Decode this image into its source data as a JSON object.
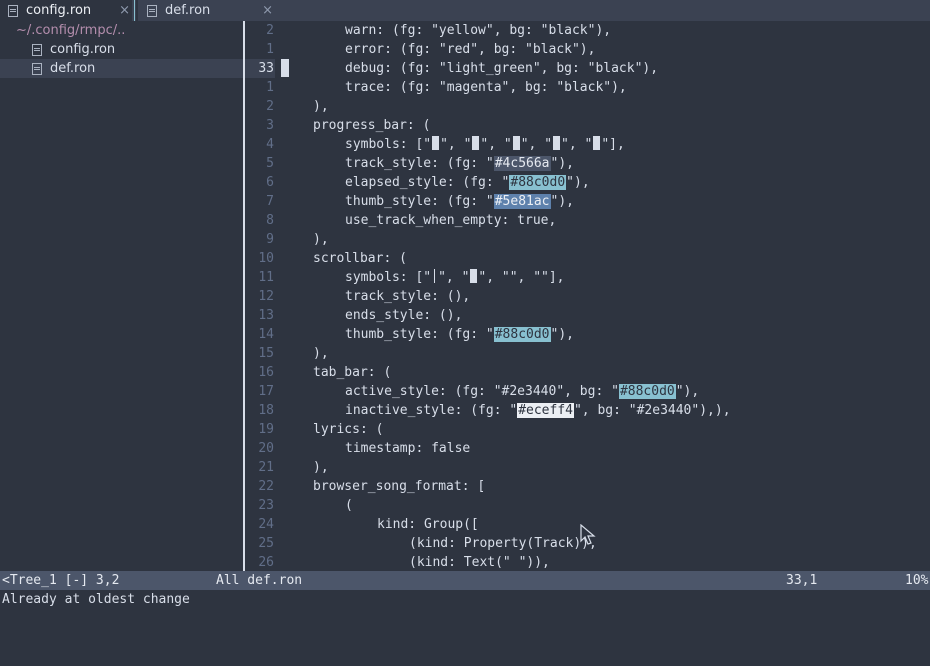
{
  "tabs": [
    {
      "label": "config.ron",
      "close": "×"
    },
    {
      "label": "def.ron",
      "close": "×"
    }
  ],
  "sidebar": {
    "root": "~/.config/rmpc/..",
    "files": [
      "config.ron",
      "def.ron"
    ],
    "active_file": "def.ron"
  },
  "editor": {
    "line_numbers": [
      "2",
      "1",
      "33",
      "1",
      "2",
      "3",
      "4",
      "5",
      "6",
      "7",
      "8",
      "9",
      "10",
      "11",
      "12",
      "13",
      "14",
      "15",
      "16",
      "17",
      "18",
      "19",
      "20",
      "21",
      "22",
      "23",
      "24",
      "25",
      "26"
    ],
    "current_line_index": 2,
    "lines": {
      "l0": "warn: (fg: \"yellow\", bg: \"black\"),",
      "l1": "error: (fg: \"red\", bg: \"black\"),",
      "l2": "debug: (fg: \"light_green\", bg: \"black\"),",
      "l3": "trace: (fg: \"magenta\", bg: \"black\"),",
      "l4": "),",
      "l5": "progress_bar: (",
      "l6a": "symbols: [\"",
      "l6b": "\", \"",
      "l6c": "\", \"",
      "l6d": "\", \"",
      "l6e": "\", \"",
      "l6f": "\"],",
      "l7a": "track_style: (fg: \"",
      "l7b": "#4c566a",
      "l7c": "\"),",
      "l8a": "elapsed_style: (fg: \"",
      "l8b": "#88c0d0",
      "l8c": "\"),",
      "l9a": "thumb_style: (fg: \"",
      "l9b": "#5e81ac",
      "l9c": "\"),",
      "l10": "use_track_when_empty: true,",
      "l11": "),",
      "l12": "scrollbar: (",
      "l13a": "symbols: [\"",
      "l13b": "\", \"",
      "l13c": "\", \"\", \"\"],",
      "l14": "track_style: (),",
      "l15": "ends_style: (),",
      "l16a": "thumb_style: (fg: \"",
      "l16b": "#88c0d0",
      "l16c": "\"),",
      "l17": "),",
      "l18": "tab_bar: (",
      "l19a": "active_style: (fg: \"#2e3440\", bg: \"",
      "l19b": "#88c0d0",
      "l19c": "\"),",
      "l20a": "inactive_style: (fg: \"",
      "l20b": "#eceff4",
      "l20c": "\", bg: \"#2e3440\"),),",
      "l21": "lyrics: (",
      "l22": "timestamp: false",
      "l23": "),",
      "l24": "browser_song_format: [",
      "l25": "(",
      "l26": "kind: Group([",
      "l27": "(kind: Property(Track)),",
      "l28": "(kind: Text(\" \")),"
    }
  },
  "statusline": {
    "left": "<Tree_1 [-] 3,2",
    "middle": "All def.ron",
    "position": "33,1",
    "percent": "10%"
  },
  "cmdline": "Already at oldest change",
  "colors": {
    "bg": "#2e3440",
    "panel": "#3b4252",
    "status": "#4c566a",
    "swatch_4c566a": "#4c566a",
    "swatch_88c0d0": "#88c0d0",
    "swatch_5e81ac": "#5e81ac",
    "swatch_eceff4": "#eceff4"
  }
}
